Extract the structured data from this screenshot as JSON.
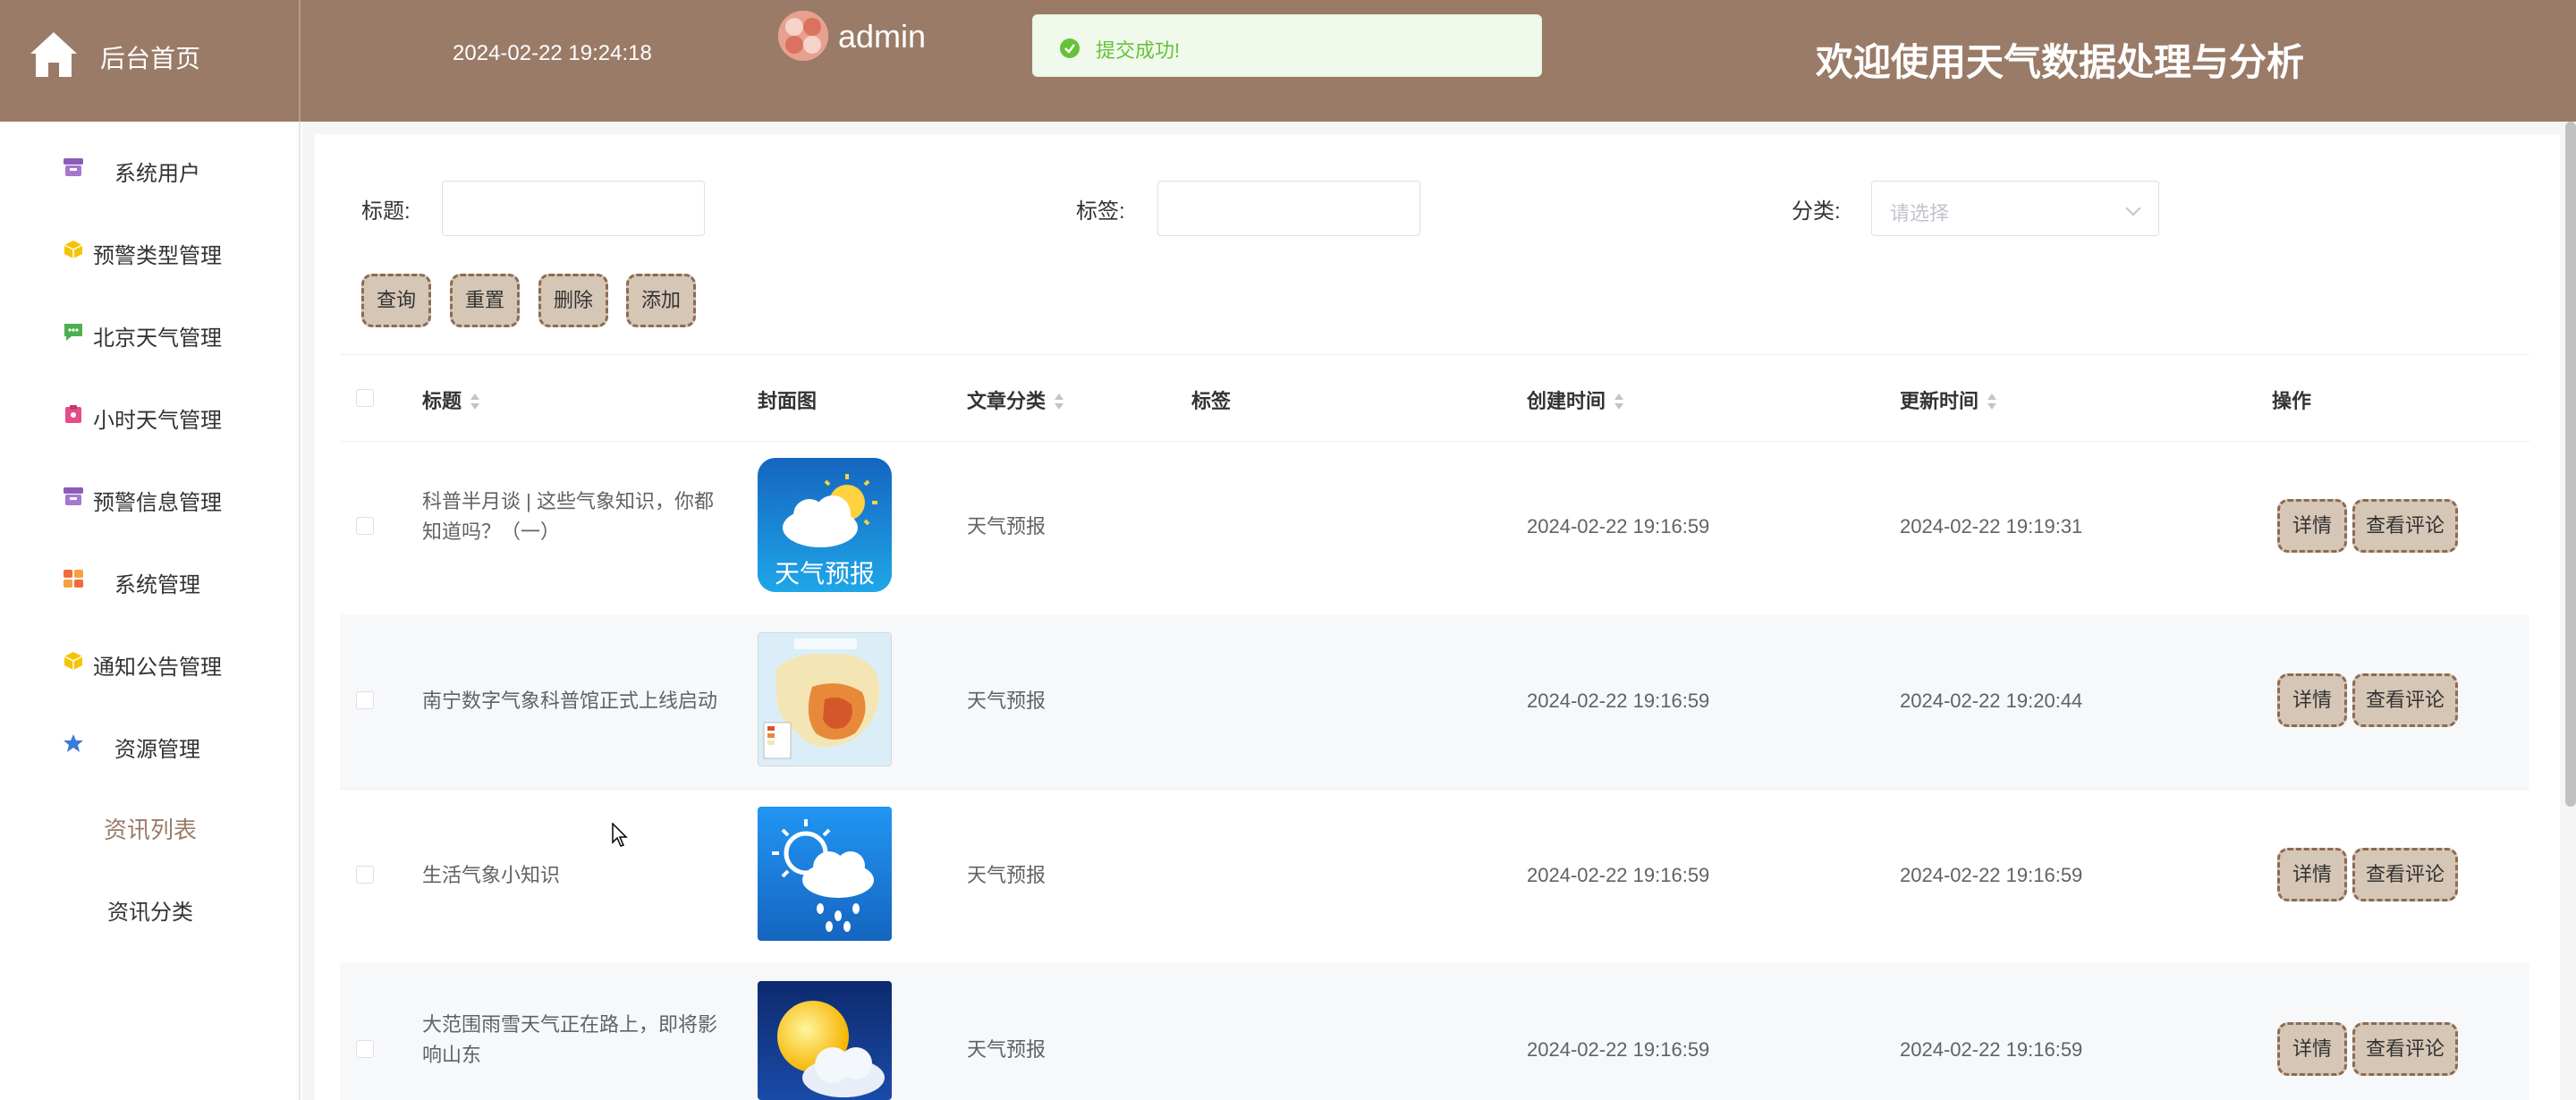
{
  "header": {
    "home_label": "后台首页",
    "datetime": "2024-02-22 19:24:18",
    "username": "admin",
    "toast": "提交成功!",
    "welcome": "欢迎使用天气数据处理与分析",
    "bg_color": "#9a7b67"
  },
  "sidebar": {
    "items": [
      {
        "label": "系统用户",
        "icon": "archive-icon"
      },
      {
        "label": "预警类型管理",
        "icon": "cube-icon"
      },
      {
        "label": "北京天气管理",
        "icon": "chat-icon"
      },
      {
        "label": "小时天气管理",
        "icon": "clipboard-icon"
      },
      {
        "label": "预警信息管理",
        "icon": "archive-icon"
      },
      {
        "label": "系统管理",
        "icon": "grid-icon"
      },
      {
        "label": "通知公告管理",
        "icon": "cube-icon"
      },
      {
        "label": "资源管理",
        "icon": "star-icon"
      }
    ],
    "sub_items": [
      {
        "label": "资讯列表",
        "active": true
      },
      {
        "label": "资讯分类",
        "active": false
      }
    ]
  },
  "filters": {
    "title_label": "标题:",
    "tag_label": "标签:",
    "category_label": "分类:",
    "category_placeholder": "请选择",
    "title_value": "",
    "tag_value": ""
  },
  "actions": {
    "query": "查询",
    "reset": "重置",
    "delete": "删除",
    "add": "添加"
  },
  "table": {
    "columns": {
      "title": "标题",
      "cover": "封面图",
      "category": "文章分类",
      "tags": "标签",
      "created": "创建时间",
      "updated": "更新时间",
      "ops": "操作"
    },
    "rows": [
      {
        "title": "科普半月谈 | 这些气象知识，你都知道吗？（一）",
        "cover": "forecast-app-icon",
        "category": "天气预报",
        "tags": "",
        "created": "2024-02-22 19:16:59",
        "updated": "2024-02-22 19:19:31"
      },
      {
        "title": "南宁数字气象科普馆正式上线启动",
        "cover": "china-map-image",
        "category": "天气预报",
        "tags": "",
        "created": "2024-02-22 19:16:59",
        "updated": "2024-02-22 19:20:44"
      },
      {
        "title": "生活气象小知识",
        "cover": "sun-rain-icon",
        "category": "天气预报",
        "tags": "",
        "created": "2024-02-22 19:16:59",
        "updated": "2024-02-22 19:16:59"
      },
      {
        "title": "大范围雨雪天气正在路上，即将影响山东",
        "cover": "sun-cloud-icon",
        "category": "天气预报",
        "tags": "",
        "created": "2024-02-22 19:16:59",
        "updated": "2024-02-22 19:16:59"
      }
    ],
    "row_actions": {
      "detail": "详情",
      "comments": "查看评论"
    },
    "cover_text_row1": "天气预报"
  }
}
